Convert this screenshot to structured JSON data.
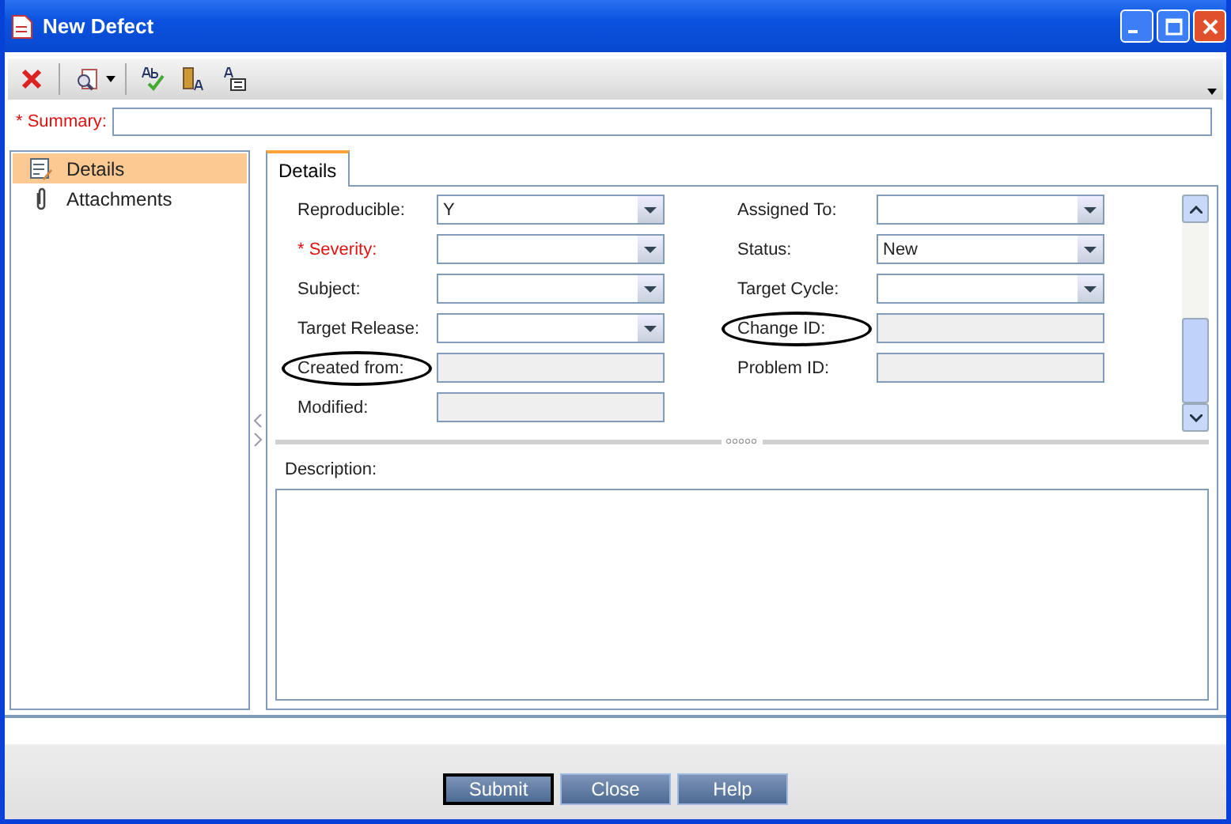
{
  "window": {
    "title": "New Defect"
  },
  "summary": {
    "label": "* Summary:",
    "required": true
  },
  "sidebar": {
    "items": [
      {
        "label": "Details",
        "kind": "details",
        "selected": true
      },
      {
        "label": "Attachments",
        "kind": "attachment",
        "selected": false
      }
    ]
  },
  "tabs": [
    {
      "label": "Details",
      "selected": true
    }
  ],
  "fields_left": [
    {
      "label": "Reproducible:",
      "kind": "dropdown",
      "value": "Y",
      "required": false,
      "circled": false
    },
    {
      "label": "* Severity:",
      "kind": "dropdown",
      "required": true,
      "circled": false
    },
    {
      "label": "Subject:",
      "kind": "dropdown",
      "required": false,
      "circled": false
    },
    {
      "label": "Target Release:",
      "kind": "dropdown",
      "required": false,
      "circled": false
    },
    {
      "label": "Created from:",
      "kind": "readonly",
      "required": false,
      "circled": true
    },
    {
      "label": "Modified:",
      "kind": "readonly",
      "required": false,
      "circled": false
    }
  ],
  "fields_right": [
    {
      "label": "Assigned To:",
      "kind": "dropdown",
      "required": false,
      "circled": false
    },
    {
      "label": "Status:",
      "kind": "dropdown",
      "value": "New",
      "required": false,
      "circled": false
    },
    {
      "label": "Target Cycle:",
      "kind": "dropdown",
      "required": false,
      "circled": false
    },
    {
      "label": "Change ID:",
      "kind": "readonly",
      "required": false,
      "circled": true
    },
    {
      "label": "Problem ID:",
      "kind": "readonly",
      "required": false,
      "circled": false
    }
  ],
  "description": {
    "label": "Description:"
  },
  "buttons": [
    {
      "label": "Submit",
      "default": true
    },
    {
      "label": "Close",
      "default": false
    },
    {
      "label": "Help",
      "default": false
    }
  ]
}
